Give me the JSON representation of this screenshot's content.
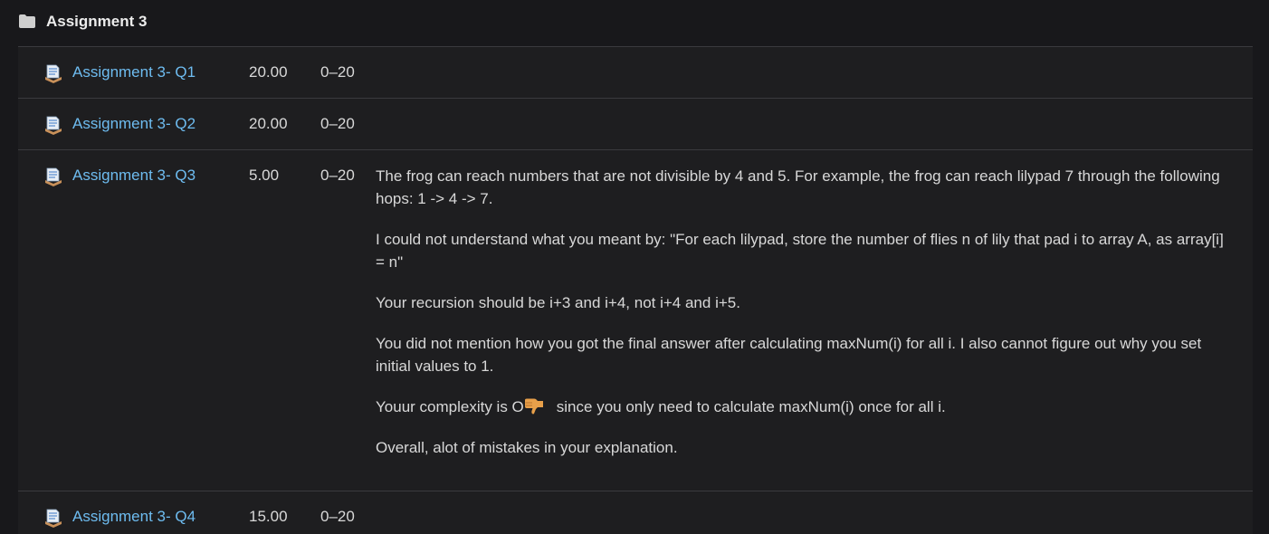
{
  "category": {
    "title": "Assignment 3",
    "icon": "folder-icon"
  },
  "items": [
    {
      "name": "Assignment 3- Q1",
      "grade": "20.00",
      "range": "0–20",
      "icon": "assignment-icon"
    },
    {
      "name": "Assignment 3- Q2",
      "grade": "20.00",
      "range": "0–20",
      "icon": "assignment-icon"
    },
    {
      "name": "Assignment 3- Q3",
      "grade": "5.00",
      "range": "0–20",
      "icon": "assignment-icon"
    },
    {
      "name": "Assignment 3- Q4",
      "grade": "15.00",
      "range": "0–20",
      "icon": "assignment-icon"
    }
  ],
  "feedback": {
    "p1": "The frog can reach numbers that are not divisible by 4 and 5. For example, the frog can reach lilypad 7 through the following hops: 1 -> 4 -> 7.",
    "p2": "I could not understand what you meant by: \"For each lilypad, store the number of flies n of lily that pad i to array A, as array[i] = n\"",
    "p3": "Your recursion should be i+3 and i+4, not i+4 and i+5.",
    "p4": "You did not mention how you got the final answer after calculating maxNum(i) for all i. I also cannot figure out why you set initial values to 1.",
    "p5_before": "Youur complexity is O",
    "p5_after": "since you only need to calculate maxNum(i) once for all i.",
    "p6": "Overall, alot of mistakes in your explanation."
  },
  "colors": {
    "background": "#18181b",
    "row_background": "#1e1e20",
    "link": "#6ebcf0",
    "text": "#d8d8d8",
    "divider": "#3a3a3e"
  }
}
